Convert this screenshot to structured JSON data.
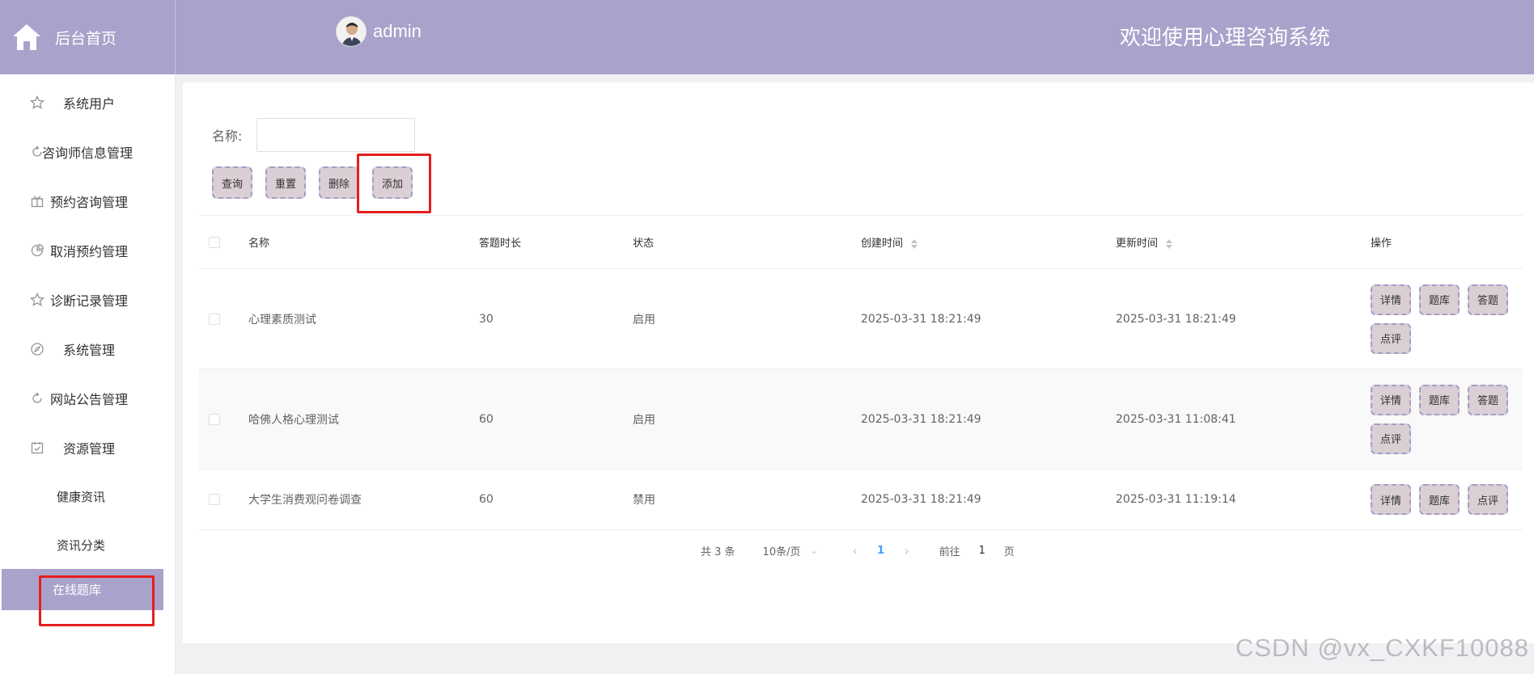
{
  "header": {
    "home_label": "后台首页",
    "username": "admin",
    "welcome": "欢迎使用心理咨询系统"
  },
  "sidebar": {
    "items": [
      {
        "label": "系统用户",
        "icon": "star-icon"
      },
      {
        "label": "咨询师信息管理",
        "icon": "refresh-icon"
      },
      {
        "label": "预约咨询管理",
        "icon": "gift-icon"
      },
      {
        "label": "取消预约管理",
        "icon": "pie-icon"
      },
      {
        "label": "诊断记录管理",
        "icon": "star-icon"
      },
      {
        "label": "系统管理",
        "icon": "compass-icon"
      },
      {
        "label": "网站公告管理",
        "icon": "refresh-icon"
      },
      {
        "label": "资源管理",
        "icon": "calendar-check-icon"
      }
    ],
    "sub_items": [
      {
        "label": "健康资讯"
      },
      {
        "label": "资讯分类"
      },
      {
        "label": "在线题库"
      }
    ]
  },
  "search": {
    "label": "名称:",
    "value": ""
  },
  "toolbar": {
    "query": "查询",
    "reset": "重置",
    "delete": "删除",
    "add": "添加"
  },
  "table": {
    "headers": {
      "name": "名称",
      "duration": "答题时长",
      "status": "状态",
      "created": "创建时间",
      "updated": "更新时间",
      "ops": "操作"
    },
    "rows": [
      {
        "name": "心理素质测试",
        "duration": "30",
        "status": "启用",
        "created": "2025-03-31 18:21:49",
        "updated": "2025-03-31 18:21:49",
        "ops": [
          "详情",
          "题库",
          "答题",
          "点评"
        ]
      },
      {
        "name": "哈佛人格心理测试",
        "duration": "60",
        "status": "启用",
        "created": "2025-03-31 18:21:49",
        "updated": "2025-03-31 11:08:41",
        "ops": [
          "详情",
          "题库",
          "答题",
          "点评"
        ]
      },
      {
        "name": "大学生消费观问卷调查",
        "duration": "60",
        "status": "禁用",
        "created": "2025-03-31 18:21:49",
        "updated": "2025-03-31 11:19:14",
        "ops": [
          "详情",
          "题库",
          "点评"
        ]
      }
    ]
  },
  "pagination": {
    "total": "共 3 条",
    "page_size": "10条/页",
    "current": "1",
    "goto_prefix": "前往",
    "goto_value": "1",
    "goto_suffix": "页"
  },
  "watermark": "CSDN @vx_CXKF10088",
  "colors": {
    "accent": "#a9a2cb",
    "button_bg": "#d9cfd4",
    "highlight": "#e51e1e",
    "link": "#409eff"
  }
}
